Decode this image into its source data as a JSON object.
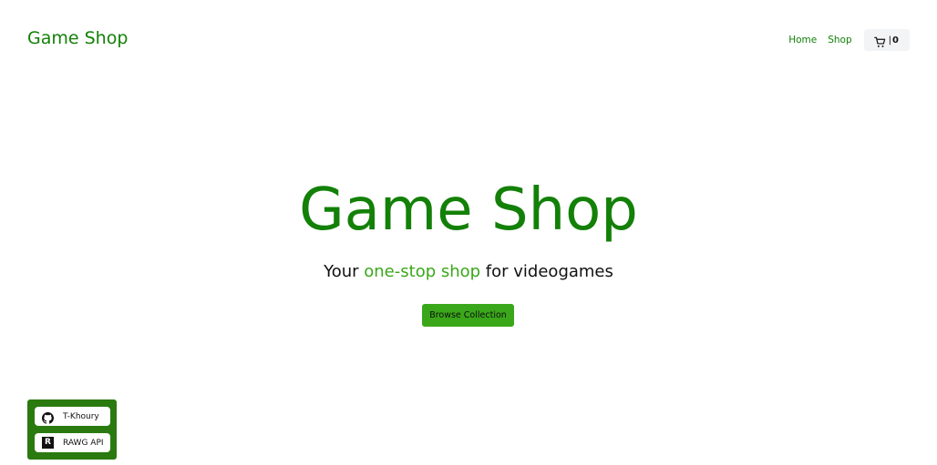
{
  "header": {
    "brand": "Game Shop",
    "nav": {
      "home": "Home",
      "shop": "Shop"
    },
    "cart": {
      "icon": "cart-icon",
      "separator": "|",
      "count": "0"
    }
  },
  "hero": {
    "title": "Game Shop",
    "subtitle_before": "Your ",
    "subtitle_accent": "one-stop shop",
    "subtitle_after": " for videogames",
    "button": "Browse Collection"
  },
  "credits": [
    {
      "icon": "github-icon",
      "label": "T-Khoury"
    },
    {
      "icon": "rawg-logo",
      "label": "RAWG API",
      "logo_letter": "R"
    }
  ],
  "colors": {
    "brand_green": "#138008",
    "accent_green": "#3aa71a",
    "credits_bg": "#2a7a10"
  }
}
